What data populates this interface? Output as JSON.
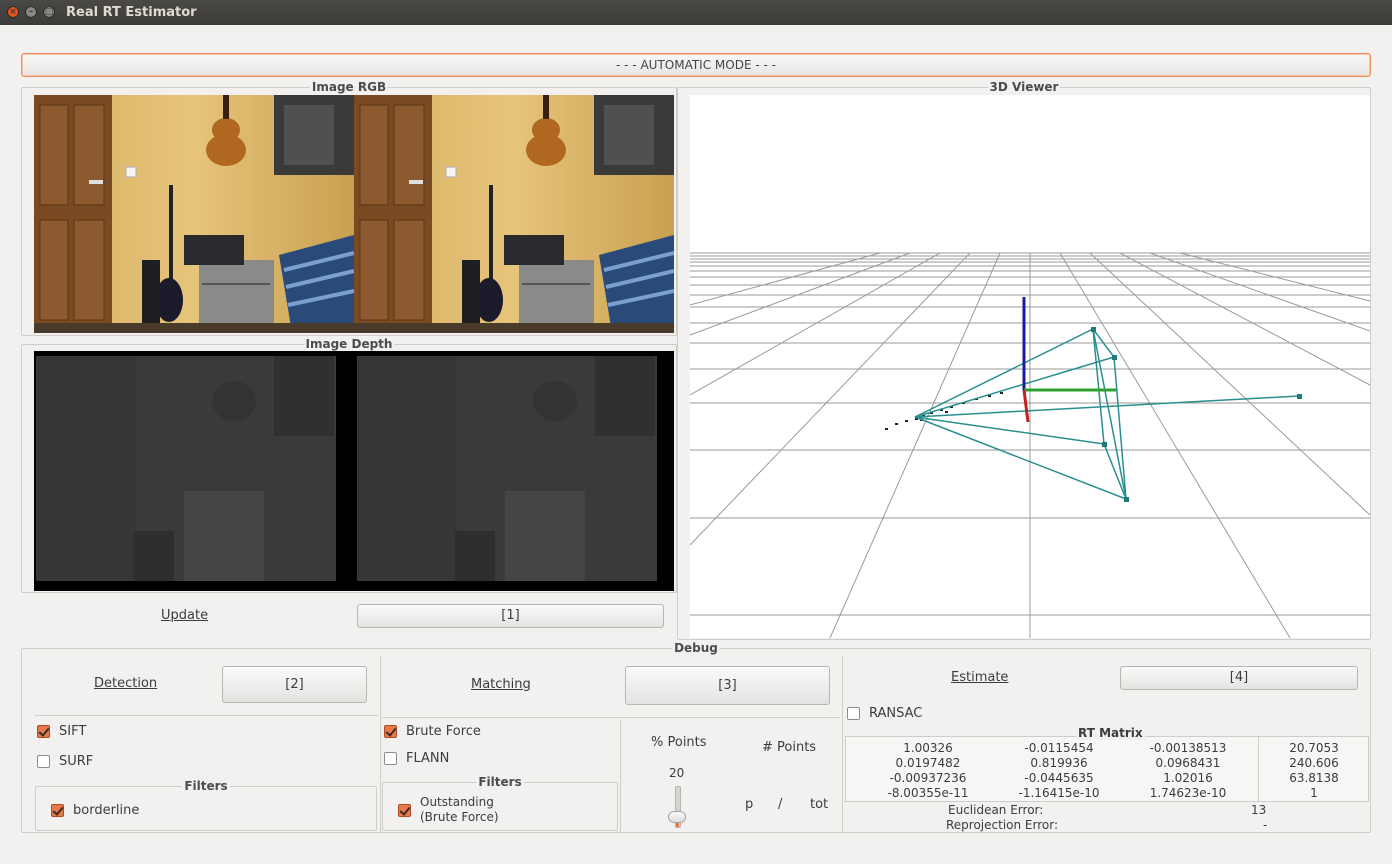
{
  "window": {
    "title": "Real RT Estimator"
  },
  "mode_button": "- - - AUTOMATIC MODE - - -",
  "rgb_group": {
    "title": "Image RGB"
  },
  "depth_group": {
    "title": "Image Depth"
  },
  "viewer_group": {
    "title": "3D Viewer"
  },
  "update": {
    "link": "Update",
    "button": "[1]"
  },
  "debug": {
    "title": "Debug",
    "detection": {
      "link": "Detection",
      "button": "[2]",
      "sift": {
        "label": "SIFT",
        "checked": true
      },
      "surf": {
        "label": "SURF",
        "checked": false
      },
      "filters_title": "Filters",
      "borderline": {
        "label": "borderline",
        "checked": true
      }
    },
    "matching": {
      "link": "Matching",
      "button": "[3]",
      "brute_force": {
        "label": "Brute Force",
        "checked": true
      },
      "flann": {
        "label": "FLANN",
        "checked": false
      },
      "filters_title": "Filters",
      "outstanding": {
        "label": "Outstanding",
        "label2": "(Brute Force)",
        "checked": true
      },
      "pct_points_label": "% Points",
      "pct_points_value": "20",
      "num_points_label": "# Points",
      "p_label": "p",
      "slash_label": "/",
      "tot_label": "tot"
    },
    "estimate": {
      "link": "Estimate",
      "button": "[4]",
      "ransac": {
        "label": "RANSAC",
        "checked": false
      },
      "rt_matrix_title": "RT Matrix",
      "rt_matrix": [
        [
          "1.00326",
          "-0.0115454",
          "-0.00138513",
          "20.7053"
        ],
        [
          "0.0197482",
          "0.819936",
          "0.0968431",
          "240.606"
        ],
        [
          "-0.00937236",
          "-0.0445635",
          "1.02016",
          "63.8138"
        ],
        [
          "-8.00355e-11",
          "-1.16415e-10",
          "1.74623e-10",
          "1"
        ]
      ],
      "euclidean_label": "Euclidean Error:",
      "euclidean_value": "13",
      "reprojection_label": "Reprojection Error:",
      "reprojection_value": "-"
    }
  }
}
